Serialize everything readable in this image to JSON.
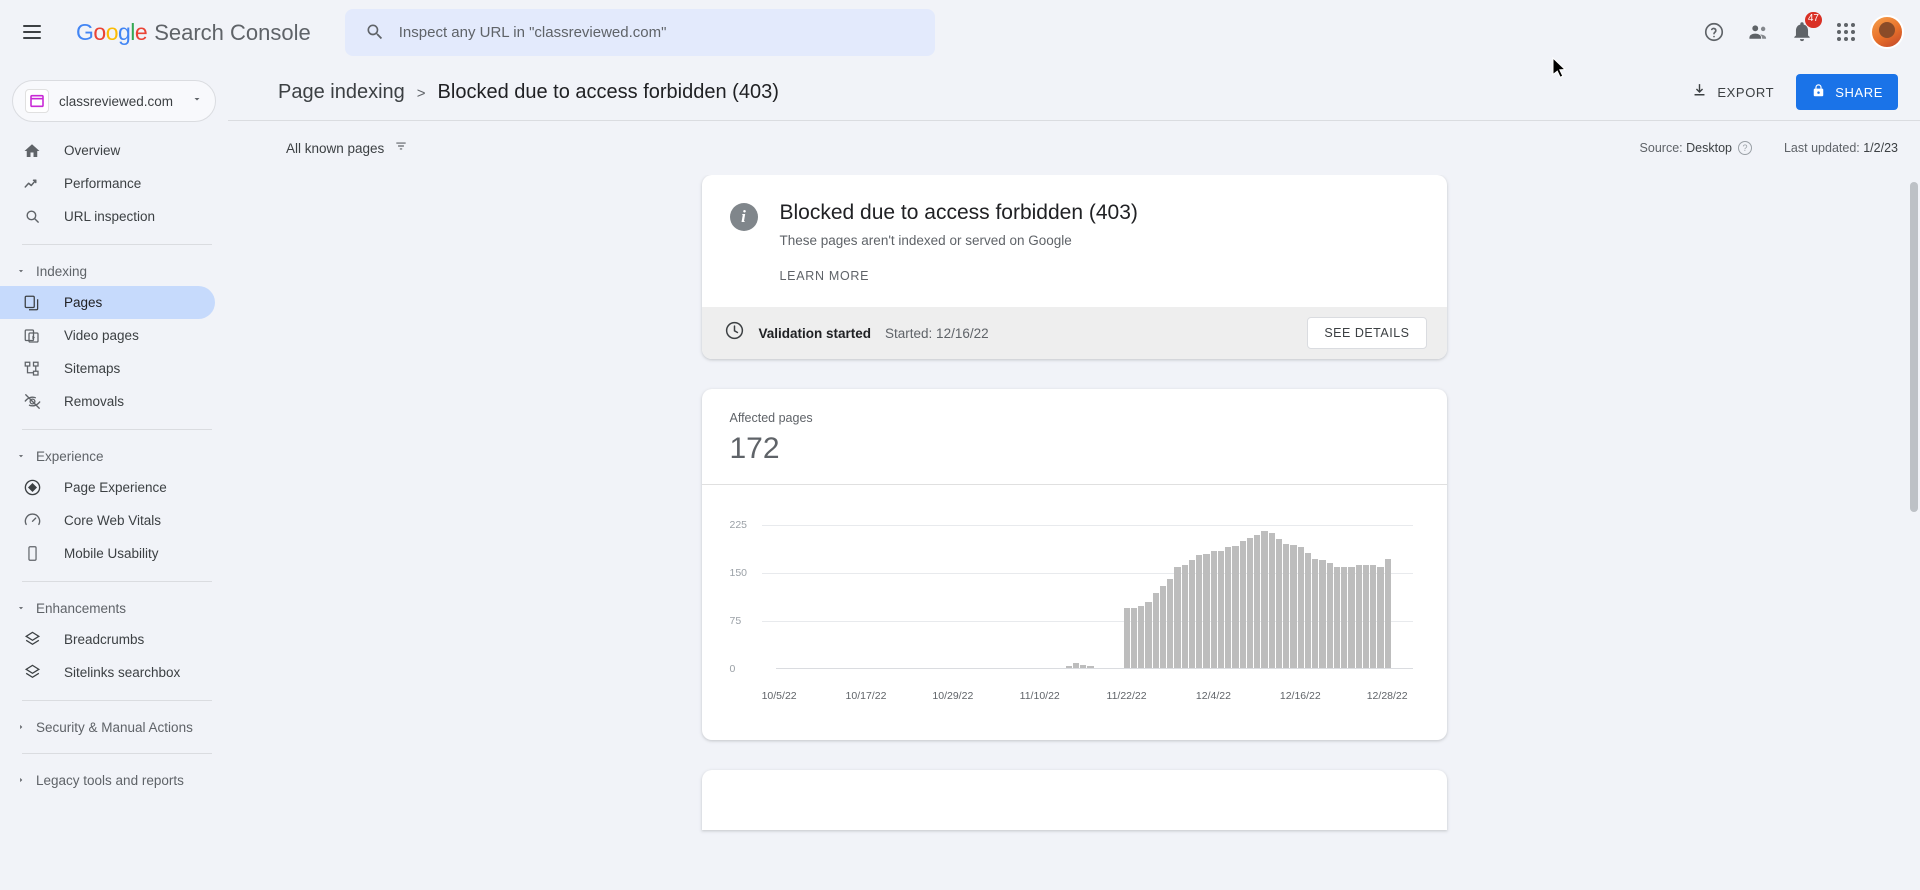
{
  "appbar": {
    "menu_icon": "hamburger-menu-icon",
    "logo_g1": "G",
    "logo_o1": "o",
    "logo_o2": "o",
    "logo_g2": "g",
    "logo_l": "l",
    "logo_e": "e",
    "product_name": "Search Console",
    "search_placeholder": "Inspect any URL in \"classreviewed.com\"",
    "search_value": "",
    "help_icon": "help-circle-icon",
    "accounts_icon": "accounts-switch-icon",
    "notifications_icon": "bell-icon",
    "notifications_count": "47",
    "apps_icon": "google-apps-grid-icon",
    "avatar_icon": "user-avatar"
  },
  "sidebar": {
    "property": {
      "label": "classreviewed.com",
      "icon": "site-property-icon",
      "dropdown_icon": "chevron-down-icon"
    },
    "top_items": [
      {
        "label": "Overview",
        "icon": "home-icon"
      },
      {
        "label": "Performance",
        "icon": "trending-up-icon"
      },
      {
        "label": "URL inspection",
        "icon": "search-icon"
      }
    ],
    "sections": [
      {
        "title": "Indexing",
        "expanded": true,
        "caret": "caret-down-icon",
        "items": [
          {
            "label": "Pages",
            "icon": "pages-copy-icon",
            "active": true
          },
          {
            "label": "Video pages",
            "icon": "video-pages-icon",
            "active": false
          },
          {
            "label": "Sitemaps",
            "icon": "sitemaps-icon",
            "active": false
          },
          {
            "label": "Removals",
            "icon": "eye-off-icon",
            "active": false
          }
        ]
      },
      {
        "title": "Experience",
        "expanded": true,
        "caret": "caret-down-icon",
        "items": [
          {
            "label": "Page Experience",
            "icon": "page-experience-icon",
            "active": false
          },
          {
            "label": "Core Web Vitals",
            "icon": "speedometer-icon",
            "active": false
          },
          {
            "label": "Mobile Usability",
            "icon": "mobile-device-icon",
            "active": false
          }
        ]
      },
      {
        "title": "Enhancements",
        "expanded": true,
        "caret": "caret-down-icon",
        "items": [
          {
            "label": "Breadcrumbs",
            "icon": "layers-icon",
            "active": false
          },
          {
            "label": "Sitelinks searchbox",
            "icon": "layers-icon",
            "active": false
          }
        ]
      }
    ],
    "collapsed_sections": [
      {
        "title": "Security & Manual Actions",
        "caret": "caret-right-icon"
      },
      {
        "title": "Legacy tools and reports",
        "caret": "caret-right-icon"
      }
    ]
  },
  "header": {
    "breadcrumb_parent": "Page indexing",
    "breadcrumb_separator": ">",
    "breadcrumb_current": "Blocked due to access forbidden (403)",
    "export_label": "EXPORT",
    "export_icon": "download-icon",
    "share_label": "SHARE",
    "share_icon": "lock-icon",
    "share_bg": "#1a73e8"
  },
  "filterbar": {
    "filter_label": "All known pages",
    "filter_icon": "filter-dropdown-icon",
    "source_prefix": "Source:",
    "source_value": "Desktop",
    "source_help_icon": "help-circle-icon",
    "last_updated_prefix": "Last updated:",
    "last_updated_value": "1/2/23"
  },
  "status_card": {
    "icon": "info-circle-icon",
    "title": "Blocked due to access forbidden (403)",
    "subtitle": "These pages aren't indexed or served on Google",
    "learn_more": "LEARN MORE",
    "validation": {
      "icon": "clock-icon",
      "title": "Validation started",
      "started": "Started: 12/16/22",
      "details_button": "SEE DETAILS"
    }
  },
  "chart_card": {
    "label": "Affected pages",
    "value": "172"
  },
  "chart_data": {
    "type": "bar",
    "title": "Affected pages",
    "xlabel": "",
    "ylabel": "",
    "ylim": [
      0,
      250
    ],
    "yticks": [
      0,
      75,
      150,
      225
    ],
    "ytick_labels": [
      "0",
      "75",
      "150",
      "225"
    ],
    "grid": true,
    "legend": false,
    "bar_color": "#bdbdbd",
    "x_tick_labels": [
      "10/5/22",
      "10/17/22",
      "10/29/22",
      "11/10/22",
      "11/22/22",
      "12/4/22",
      "12/16/22",
      "12/28/22"
    ],
    "x_tick_positions": [
      0,
      12,
      24,
      36,
      48,
      60,
      72,
      84
    ],
    "categories": [
      "10/5/22",
      "10/6/22",
      "10/7/22",
      "10/8/22",
      "10/9/22",
      "10/10/22",
      "10/11/22",
      "10/12/22",
      "10/13/22",
      "10/14/22",
      "10/15/22",
      "10/16/22",
      "10/17/22",
      "10/18/22",
      "10/19/22",
      "10/20/22",
      "10/21/22",
      "10/22/22",
      "10/23/22",
      "10/24/22",
      "10/25/22",
      "10/26/22",
      "10/27/22",
      "10/28/22",
      "10/29/22",
      "10/30/22",
      "10/31/22",
      "11/1/22",
      "11/2/22",
      "11/3/22",
      "11/4/22",
      "11/5/22",
      "11/6/22",
      "11/7/22",
      "11/8/22",
      "11/9/22",
      "11/10/22",
      "11/11/22",
      "11/12/22",
      "11/13/22",
      "11/14/22",
      "11/15/22",
      "11/16/22",
      "11/17/22",
      "11/18/22",
      "11/19/22",
      "11/20/22",
      "11/21/22",
      "11/22/22",
      "11/23/22",
      "11/24/22",
      "11/25/22",
      "11/26/22",
      "11/27/22",
      "11/28/22",
      "11/29/22",
      "11/30/22",
      "12/1/22",
      "12/2/22",
      "12/3/22",
      "12/4/22",
      "12/5/22",
      "12/6/22",
      "12/7/22",
      "12/8/22",
      "12/9/22",
      "12/10/22",
      "12/11/22",
      "12/12/22",
      "12/13/22",
      "12/14/22",
      "12/15/22",
      "12/16/22",
      "12/17/22",
      "12/18/22",
      "12/19/22",
      "12/20/22",
      "12/21/22",
      "12/22/22",
      "12/23/22",
      "12/24/22",
      "12/25/22",
      "12/26/22",
      "12/27/22",
      "12/28/22",
      "12/29/22",
      "12/30/22",
      "12/31/22"
    ],
    "values": [
      0,
      0,
      0,
      0,
      0,
      0,
      0,
      0,
      0,
      0,
      0,
      0,
      0,
      0,
      0,
      0,
      0,
      0,
      0,
      0,
      0,
      0,
      0,
      0,
      0,
      0,
      0,
      0,
      0,
      0,
      0,
      0,
      0,
      0,
      0,
      0,
      0,
      0,
      0,
      0,
      5,
      9,
      7,
      5,
      0,
      0,
      0,
      0,
      95,
      96,
      98,
      105,
      118,
      130,
      140,
      160,
      163,
      170,
      178,
      180,
      185,
      185,
      190,
      192,
      200,
      205,
      210,
      215,
      213,
      203,
      195,
      194,
      190,
      182,
      172,
      170,
      165,
      160,
      160,
      160,
      162,
      162,
      162,
      160,
      172,
      0,
      0,
      0
    ]
  },
  "cursor": {
    "icon": "mouse-cursor"
  }
}
